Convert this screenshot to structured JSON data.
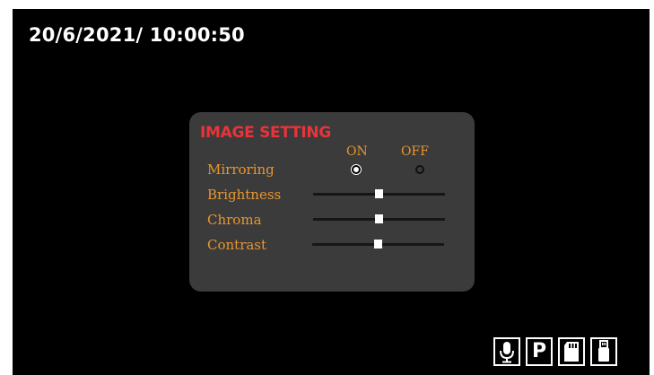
{
  "timestamp": "20/6/2021/  10:00:50",
  "panel": {
    "title": "IMAGE SETTING",
    "on_label": "ON",
    "off_label": "OFF",
    "rows": [
      {
        "label": "Mirroring",
        "type": "radio",
        "selected": "ON"
      },
      {
        "label": "Brightness",
        "type": "slider",
        "value": 0.5
      },
      {
        "label": "Chroma",
        "type": "slider",
        "value": 0.5
      },
      {
        "label": "Contrast",
        "type": "slider",
        "value": 0.5
      }
    ]
  },
  "status_icons": {
    "mic": "microphone-icon",
    "parking": "P",
    "sd": "sd-card-icon",
    "usb": "usb-drive-icon"
  },
  "colors": {
    "background": "#000000",
    "panel": "#3b3b3b",
    "title": "#e8343a",
    "label": "#e8962f"
  }
}
